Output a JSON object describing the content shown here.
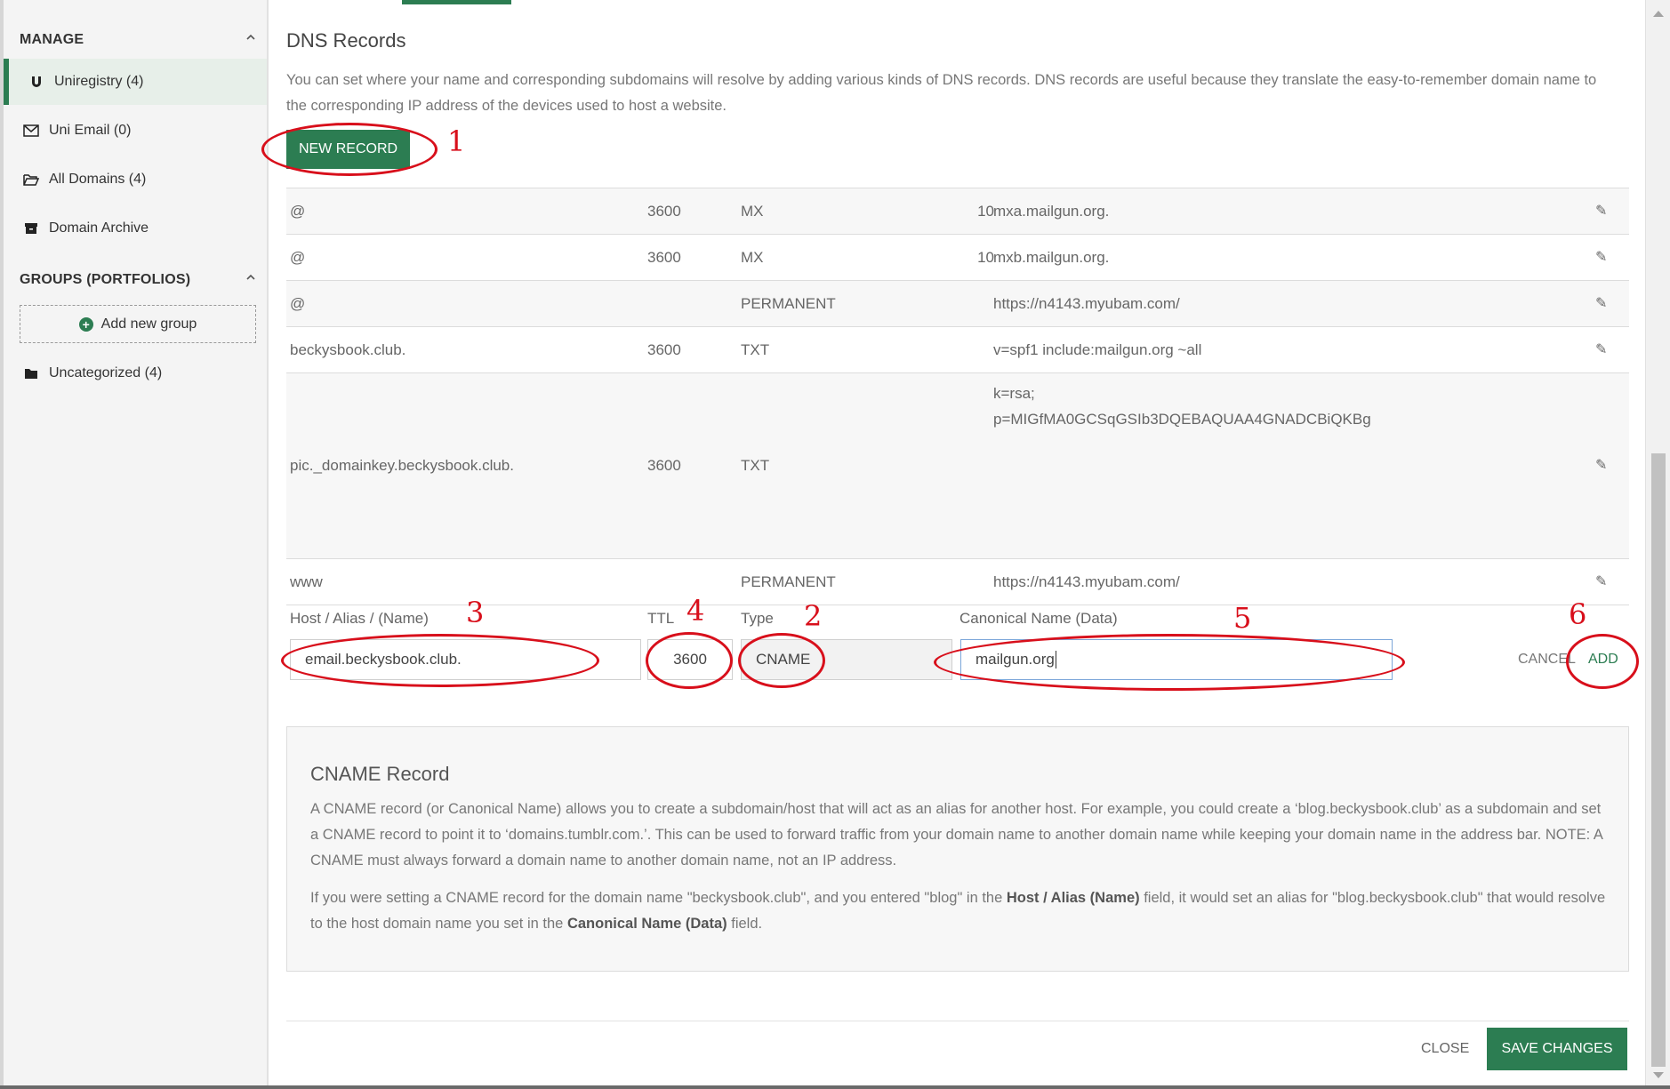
{
  "sidebar": {
    "manage_heading": "MANAGE",
    "items": [
      {
        "label": "Uniregistry (4)",
        "icon": "magnet-icon"
      },
      {
        "label": "Uni Email (0)",
        "icon": "envelope-icon"
      },
      {
        "label": "All Domains (4)",
        "icon": "folder-open-icon"
      },
      {
        "label": "Domain Archive",
        "icon": "archive-icon"
      }
    ],
    "groups_heading": "GROUPS (PORTFOLIOS)",
    "add_group_label": "Add new group",
    "uncategorized_label": "Uncategorized (4)"
  },
  "main": {
    "title": "DNS Records",
    "intro": "You can set where your name and corresponding subdomains will resolve by adding various kinds of DNS records. DNS records are useful because they translate the easy-to-remember domain name to the corresponding IP address of the devices used to host a website.",
    "new_record_label": "NEW RECORD"
  },
  "records": [
    {
      "host": "@",
      "ttl": "3600",
      "type": "MX",
      "priority": "10",
      "data": "mxa.mailgun.org."
    },
    {
      "host": "@",
      "ttl": "3600",
      "type": "MX",
      "priority": "10",
      "data": "mxb.mailgun.org."
    },
    {
      "host": "@",
      "ttl": "",
      "type": "PERMANENT",
      "priority": "",
      "data": "https://n4143.myubam.com/"
    },
    {
      "host": "beckysbook.club.",
      "ttl": "3600",
      "type": "TXT",
      "priority": "",
      "data": "v=spf1 include:mailgun.org ~all"
    },
    {
      "host": "pic._domainkey.beckysbook.club.",
      "ttl": "3600",
      "type": "TXT",
      "priority": "",
      "data_line1": "k=rsa;",
      "data_line2": "p=MIGfMA0GCSqGSIb3DQEBAQUAA4GNADCBiQKBg"
    },
    {
      "host": "www",
      "ttl": "",
      "type": "PERMANENT",
      "priority": "",
      "data": "https://n4143.myubam.com/"
    }
  ],
  "form": {
    "host_label": "Host / Alias / (Name)",
    "ttl_label": "TTL",
    "type_label": "Type",
    "data_label": "Canonical Name (Data)",
    "host_value": "email.beckysbook.club.",
    "ttl_value": "3600",
    "type_value": "CNAME",
    "data_value": "mailgun.org",
    "cancel_label": "CANCEL",
    "add_label": "ADD"
  },
  "annotations": [
    "1",
    "2",
    "3",
    "4",
    "5",
    "6"
  ],
  "info": {
    "title": "CNAME Record",
    "para1": "A CNAME record (or Canonical Name) allows you to create a subdomain/host that will act as an alias for another host. For example, you could create a ‘blog.beckysbook.club’ as a subdomain and set a CNAME record to point it to ‘domains.tumblr.com.’. This can be used to forward traffic from your domain name to another domain name while keeping your domain name in the address bar. NOTE: A CNAME must always forward a domain name to another domain name, not an IP address.",
    "para2_a": "If you were setting a CNAME record for the domain name \"beckysbook.club\", and you entered \"blog\" in the ",
    "para2_b": "Host / Alias (Name)",
    "para2_c": " field, it would set an alias for \"blog.beckysbook.club\" that would resolve to the host domain name you set in the ",
    "para2_d": "Canonical Name (Data)",
    "para2_e": " field."
  },
  "footer": {
    "close_label": "CLOSE",
    "save_label": "SAVE CHANGES"
  },
  "colors": {
    "accent_green": "#2c7d52",
    "annotation_red": "#d80f1b"
  }
}
